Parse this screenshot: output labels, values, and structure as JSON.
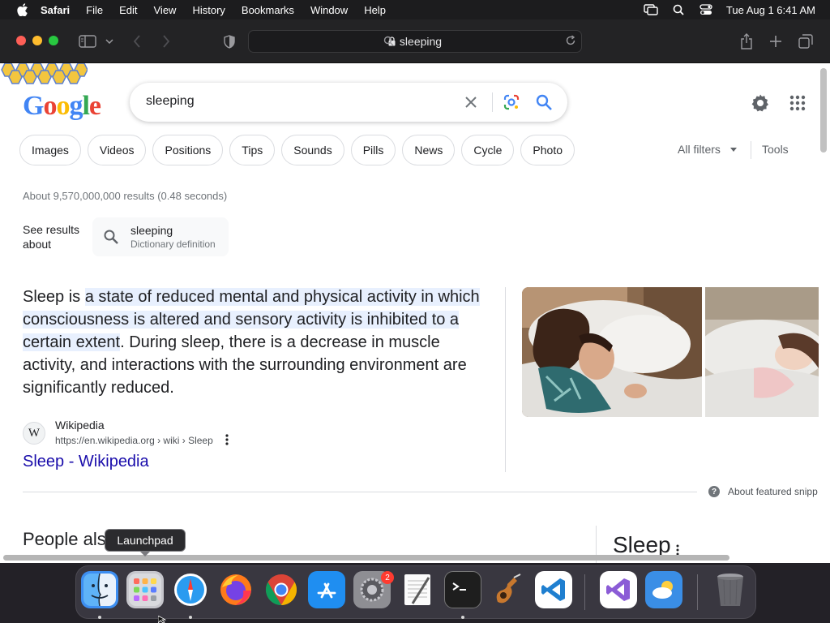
{
  "menubar": {
    "app_name": "Safari",
    "items": [
      "File",
      "Edit",
      "View",
      "History",
      "Bookmarks",
      "Window",
      "Help"
    ],
    "clock": "Tue Aug 1  6:41 AM"
  },
  "browser": {
    "address": "sleeping"
  },
  "google": {
    "logo_letters": [
      "G",
      "o",
      "o",
      "g",
      "l",
      "e"
    ],
    "query": "sleeping",
    "chips": [
      "Images",
      "Videos",
      "Positions",
      "Tips",
      "Sounds",
      "Pills",
      "News",
      "Cycle",
      "Photo"
    ],
    "all_filters": "All filters",
    "tools": "Tools",
    "result_stats": "About 9,570,000,000 results (0.48 seconds)",
    "see_results_about": "See results about",
    "dictionary": {
      "word": "sleeping",
      "sub": "Dictionary definition"
    },
    "snippet": {
      "before": "Sleep is ",
      "highlight": "a state of reduced mental and physical activity in which consciousness is altered and sensory activity is inhibited to a certain extent",
      "after": ". During sleep, there is a decrease in muscle activity, and interactions with the surrounding environment are significantly reduced."
    },
    "source": {
      "favicon": "W",
      "site": "Wikipedia",
      "url": "https://en.wikipedia.org › wiki › Sleep",
      "link": "Sleep - Wikipedia"
    },
    "featured_help": "?",
    "featured_label": "About featured snipp",
    "people_also": "People also",
    "kp_title": "Sleep"
  },
  "dock": {
    "tooltip": "Launchpad",
    "badge": "2",
    "apps": [
      "Finder",
      "Launchpad",
      "Safari",
      "Firefox",
      "Chrome",
      "App Store",
      "System Settings",
      "TextEdit",
      "Terminal",
      "Instruments",
      "Visual Studio Code",
      "Visual Studio",
      "Weather",
      "Trash"
    ]
  },
  "colors": {
    "google_blue": "#4285f4",
    "google_red": "#ea4335",
    "google_yellow": "#fbbc05",
    "google_green": "#34a853",
    "link": "#1a0dab",
    "highlight": "#e8f0fe"
  }
}
